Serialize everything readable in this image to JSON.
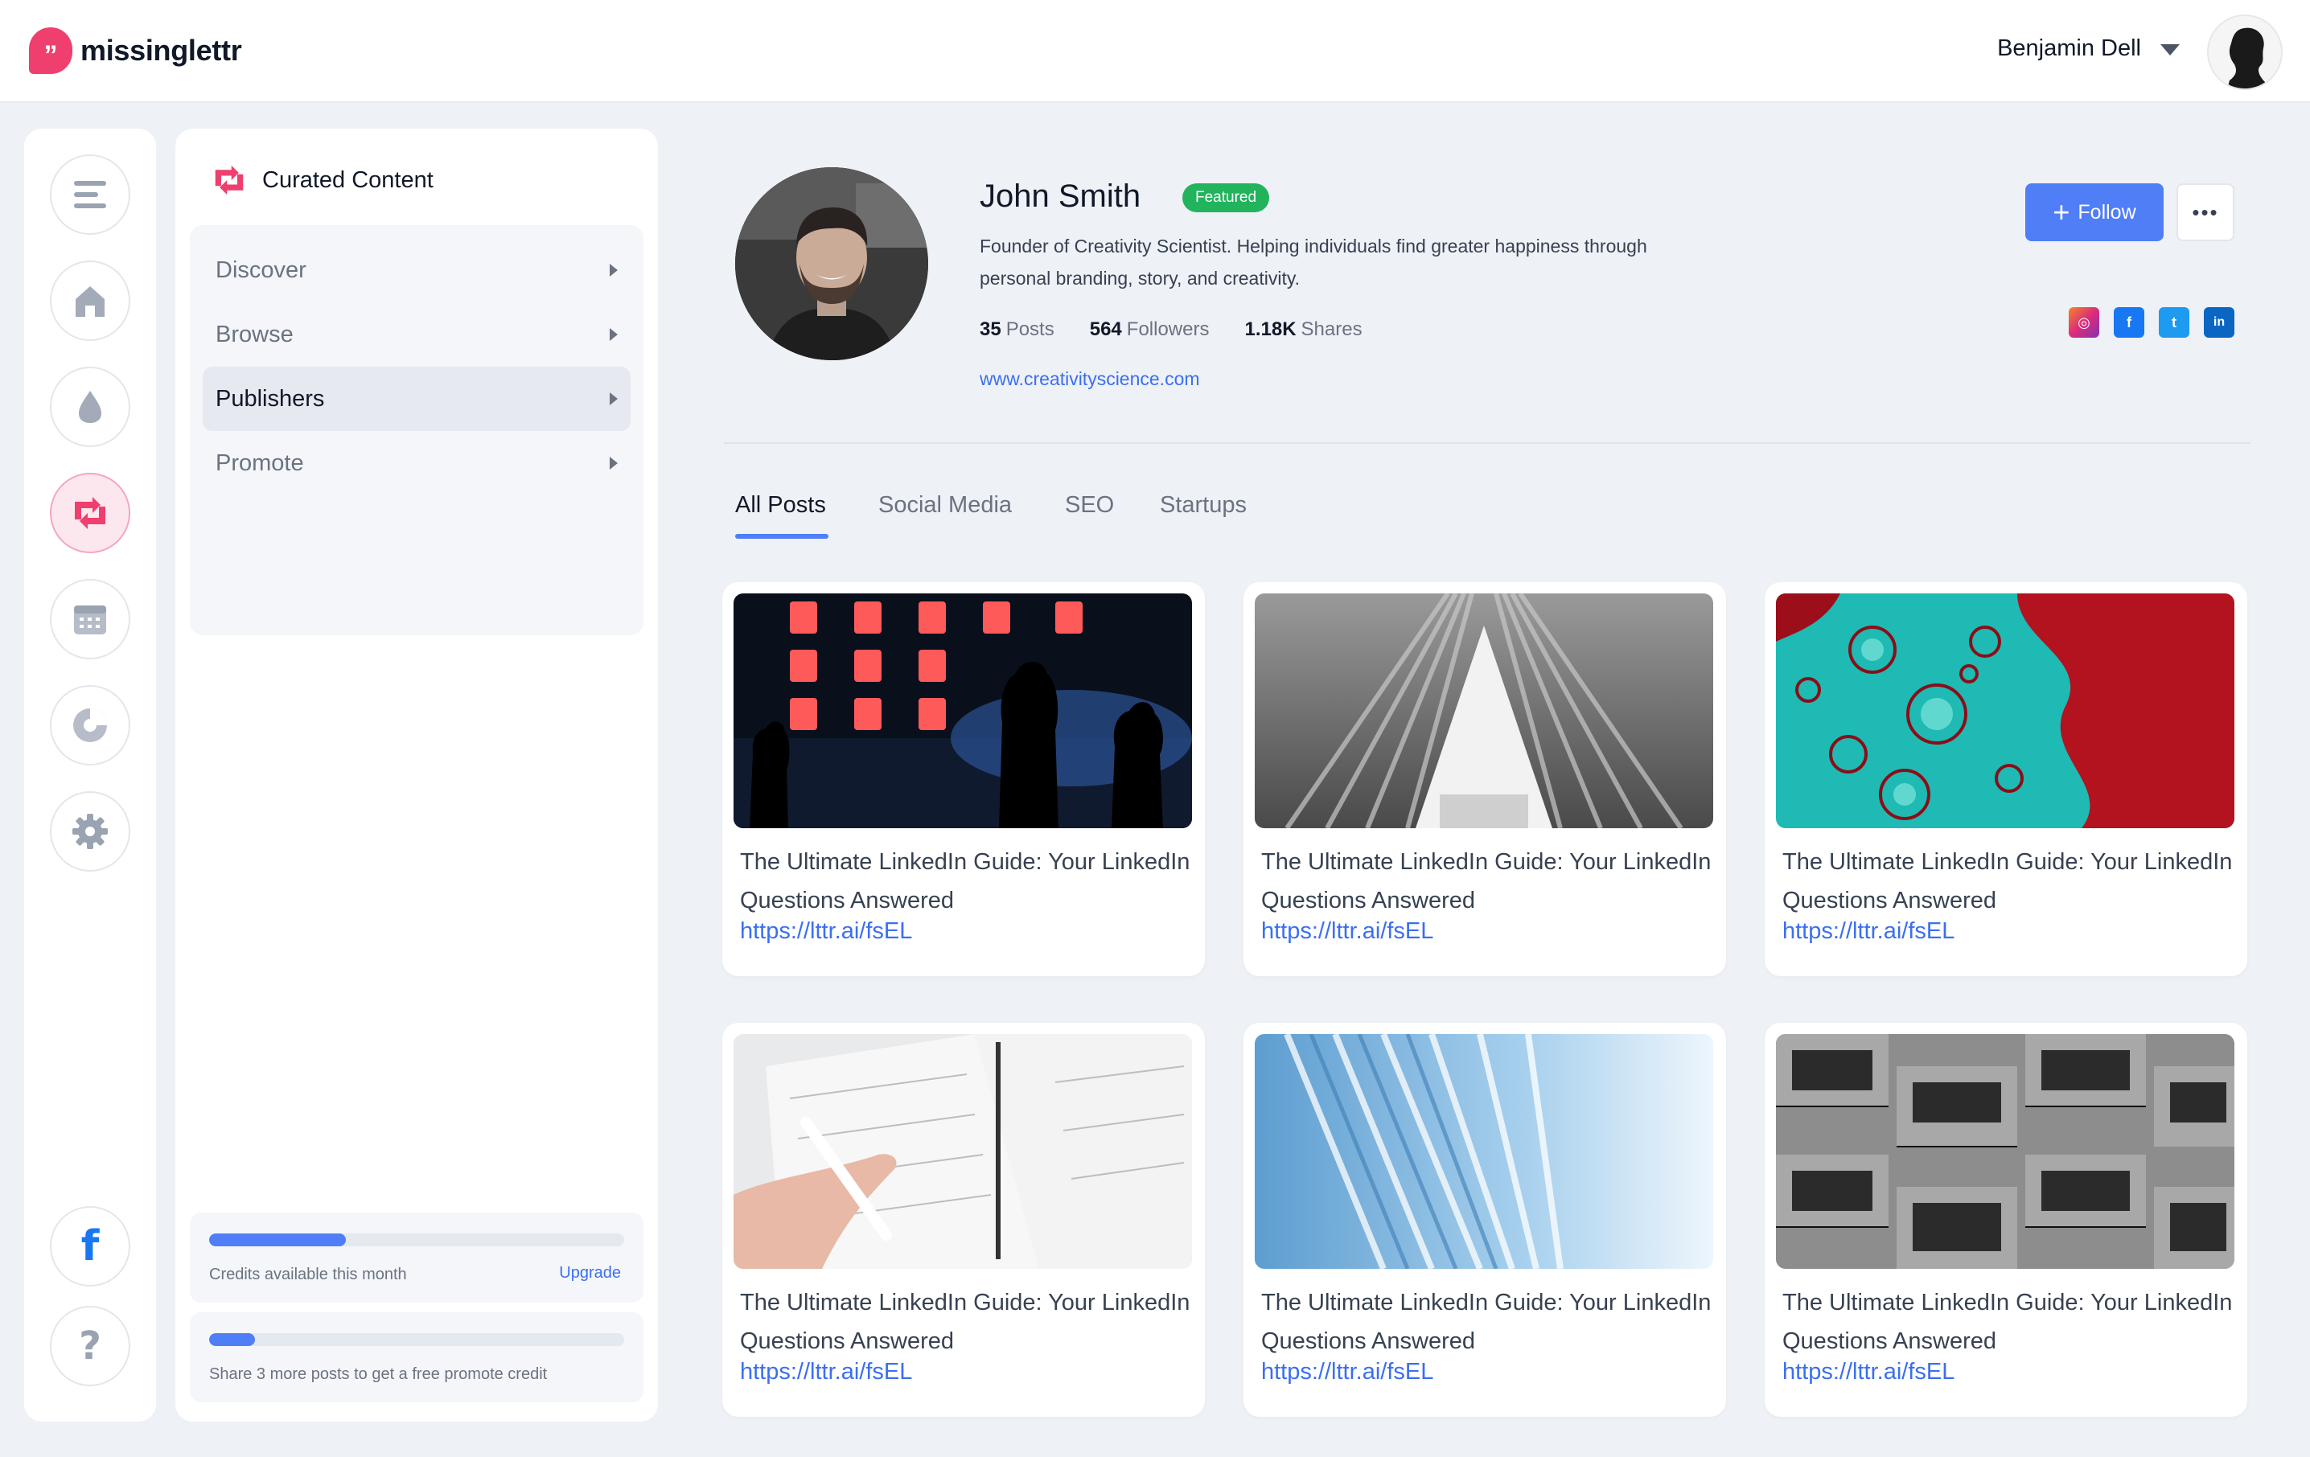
{
  "app": {
    "name": "missinglettr",
    "logo_glyph": "”"
  },
  "user": {
    "name": "Benjamin Dell"
  },
  "rail": {
    "icons": [
      "menu-icon",
      "home-icon",
      "drop-icon",
      "curated-content-icon",
      "calendar-icon",
      "analytics-icon",
      "settings-icon",
      "facebook-icon",
      "help-icon"
    ],
    "facebook_glyph": "f",
    "help_glyph": "?"
  },
  "sidebar": {
    "title": "Curated Content",
    "items": [
      {
        "label": "Discover",
        "active": false
      },
      {
        "label": "Browse",
        "active": false
      },
      {
        "label": "Publishers",
        "active": true
      },
      {
        "label": "Promote",
        "active": false
      }
    ],
    "credits": {
      "label": "Credits available this month",
      "upgrade": "Upgrade",
      "progress": 0.33
    },
    "share": {
      "label": "Share 3 more posts to get a free promote credit",
      "progress": 0.11
    }
  },
  "profile": {
    "name": "John Smith",
    "badge": "Featured",
    "bio": "Founder of Creativity Scientist. Helping individuals find greater happiness through personal branding, story, and creativity.",
    "stats": [
      {
        "value": "35",
        "label": "Posts"
      },
      {
        "value": "564",
        "label": "Followers"
      },
      {
        "value": "1.18K",
        "label": "Shares"
      }
    ],
    "website": "www.creativityscience.com",
    "follow_label": "Follow",
    "more_label": "•••",
    "socials": [
      {
        "name": "instagram",
        "glyph": "◎",
        "color": "#d6336c"
      },
      {
        "name": "facebook",
        "glyph": "f",
        "color": "#1877f2"
      },
      {
        "name": "twitter",
        "glyph": "t",
        "color": "#1d9bf0"
      },
      {
        "name": "linkedin",
        "glyph": "in",
        "color": "#0a66c2"
      }
    ]
  },
  "tabs": [
    {
      "label": "All Posts",
      "active": true
    },
    {
      "label": "Social Media",
      "active": false
    },
    {
      "label": "SEO",
      "active": false
    },
    {
      "label": "Startups",
      "active": false
    }
  ],
  "posts": [
    {
      "title": "The Ultimate LinkedIn Guide: Your LinkedIn Questions Answered",
      "link": "https://lttr.ai/fsEL",
      "image": "concert-stage"
    },
    {
      "title": "The Ultimate LinkedIn Guide: Your LinkedIn Questions Answered",
      "link": "https://lttr.ai/fsEL",
      "image": "architecture-ribs"
    },
    {
      "title": "The Ultimate LinkedIn Guide: Your LinkedIn Questions Answered",
      "link": "https://lttr.ai/fsEL",
      "image": "fluid-art"
    },
    {
      "title": "The Ultimate LinkedIn Guide: Your LinkedIn Questions Answered",
      "link": "https://lttr.ai/fsEL",
      "image": "planner-notebook"
    },
    {
      "title": "The Ultimate LinkedIn Guide: Your LinkedIn Questions Answered",
      "link": "https://lttr.ai/fsEL",
      "image": "blue-curtain"
    },
    {
      "title": "The Ultimate LinkedIn Guide: Your LinkedIn Questions Answered",
      "link": "https://lttr.ai/fsEL",
      "image": "building-balconies"
    }
  ],
  "colors": {
    "accent": "#4f7ef7",
    "brand": "#ee3f6e",
    "featured": "#22b35d",
    "link": "#3b6ff0"
  }
}
